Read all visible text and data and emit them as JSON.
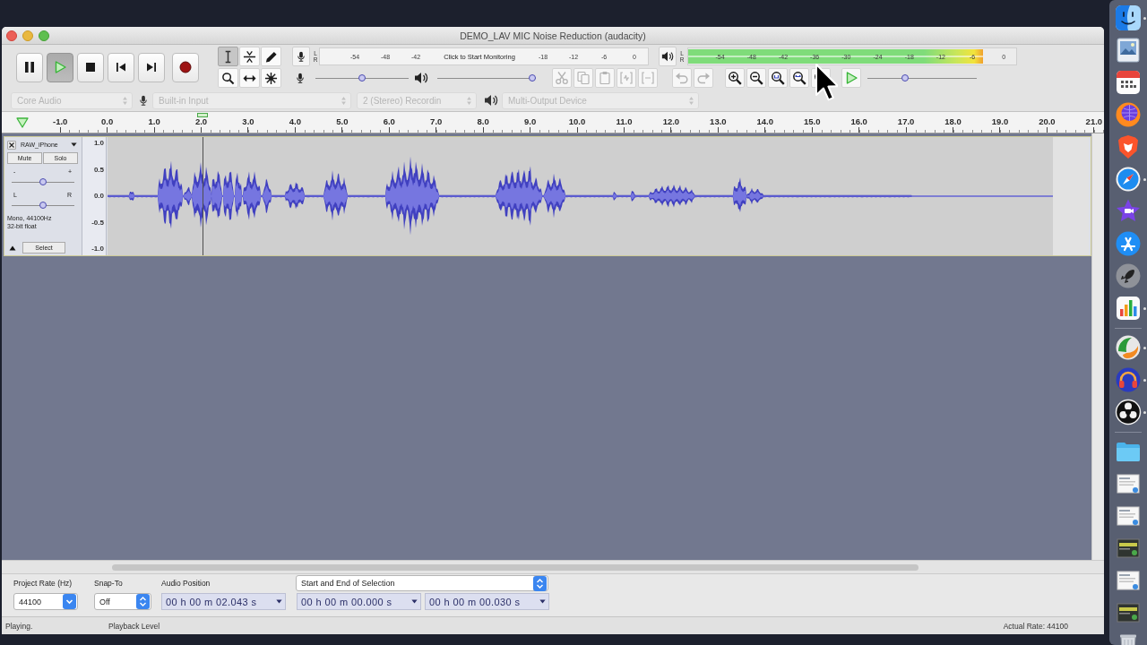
{
  "window": {
    "title": "DEMO_LAV MIC Noise Reduction (audacity)"
  },
  "transport": [
    {
      "kind": "pause",
      "pressed": false
    },
    {
      "kind": "play",
      "pressed": true
    },
    {
      "kind": "stop",
      "pressed": false
    },
    {
      "kind": "skip_start",
      "pressed": false
    },
    {
      "kind": "skip_end",
      "pressed": false
    },
    {
      "kind": "record",
      "pressed": false
    }
  ],
  "tools": [
    {
      "kind": "select",
      "selected": true
    },
    {
      "kind": "envelope",
      "selected": false
    },
    {
      "kind": "draw",
      "selected": false
    },
    {
      "kind": "zoom",
      "selected": false
    },
    {
      "kind": "time_shift",
      "selected": false
    },
    {
      "kind": "multi",
      "selected": false
    }
  ],
  "record_meter": {
    "channels": [
      "L",
      "R"
    ],
    "ticks_before": [
      "-54",
      "-48",
      "-42"
    ],
    "prompt": "Click to Start Monitoring",
    "ticks_after": [
      "-18",
      "-12",
      "-6",
      "0"
    ]
  },
  "playback_meter": {
    "channels": [
      "L",
      "R"
    ],
    "ticks": [
      "-54",
      "-48",
      "-42",
      "-36",
      "-30",
      "-24",
      "-18",
      "-12",
      "-6",
      "0"
    ],
    "level": 0.9
  },
  "mixer": {
    "input": {
      "level": 0.5
    },
    "output": {
      "level": 1
    }
  },
  "edit_tools": [
    {
      "kind": "cut",
      "disabled": true
    },
    {
      "kind": "copy",
      "disabled": true
    },
    {
      "kind": "paste",
      "disabled": true
    },
    {
      "kind": "trim",
      "disabled": true
    },
    {
      "kind": "silence",
      "disabled": true
    },
    {
      "kind": "undo",
      "disabled": true
    },
    {
      "kind": "redo",
      "disabled": true
    },
    {
      "kind": "zoom_in",
      "disabled": false
    },
    {
      "kind": "zoom_out",
      "disabled": false
    },
    {
      "kind": "fit_selection",
      "disabled": false
    },
    {
      "kind": "fit_project",
      "disabled": false
    },
    {
      "kind": "zoom_toggle",
      "disabled": false
    },
    {
      "kind": "play_at_speed",
      "disabled": false
    }
  ],
  "speed_slider": {
    "level": 0.33
  },
  "devices": [
    {
      "kind": "host",
      "value": "Core Audio",
      "disabled": true
    },
    {
      "kind": "input",
      "value": "Built-in Input",
      "disabled": true
    },
    {
      "kind": "channels",
      "value": "2 (Stereo) Recordin",
      "disabled": true
    },
    {
      "kind": "output",
      "value": "Multi-Output Device",
      "disabled": true
    }
  ],
  "ruler": {
    "labels": [
      "-1.0",
      "0.0",
      "1.0",
      "2.0",
      "3.0",
      "4.0",
      "5.0",
      "6.0",
      "7.0",
      "8.0",
      "9.0",
      "10.0",
      "11.0",
      "12.0",
      "13.0",
      "14.0",
      "15.0",
      "16.0",
      "17.0",
      "18.0",
      "19.0",
      "20.0",
      "21.0"
    ]
  },
  "track": {
    "name": "RAW_iPhone",
    "mute": {
      "label": "Mute",
      "on": false
    },
    "solo": {
      "label": "Solo",
      "on": false
    },
    "gain": {
      "min_label": "-",
      "max_label": "+",
      "level": 0.5
    },
    "pan": {
      "min_label": "L",
      "max_label": "R",
      "level": 0.5
    },
    "info": [
      "Mono, 44100Hz",
      "32-bit float"
    ],
    "select_label": "Select",
    "scale": [
      "1.0",
      "0.5",
      "0.0",
      "-0.5",
      "-1.0"
    ]
  },
  "selection_bar": {
    "project_rate": {
      "label": "Project Rate (Hz)",
      "value": "44100"
    },
    "snap_to": {
      "label": "Snap-To",
      "value": "Off"
    },
    "audio_position": {
      "label": "Audio Position",
      "value": "00 h 00 m 02.043 s"
    },
    "selection_mode": "Start and End of Selection",
    "selection_start": "00 h 00 m 00.000 s",
    "selection_end": "00 h 00 m 00.030 s"
  },
  "status_bar": [
    "Playing.",
    "Playback Level",
    "Actual Rate: 44100"
  ],
  "dock": {
    "groups": [
      {
        "items": [
          {
            "kind": "face",
            "running": true
          },
          {
            "kind": "photo_viewer",
            "running": false
          },
          {
            "kind": "calendar",
            "running": false
          },
          {
            "kind": "fox_globe",
            "running": false
          },
          {
            "kind": "shield",
            "running": false
          },
          {
            "kind": "compass",
            "running": true
          },
          {
            "kind": "star",
            "running": false
          },
          {
            "kind": "sticks",
            "running": false
          },
          {
            "kind": "rocket",
            "running": false
          },
          {
            "kind": "bar_chart",
            "running": true
          }
        ]
      },
      {
        "items": [
          {
            "kind": "swirl",
            "running": true
          },
          {
            "kind": "headphones",
            "running": true
          },
          {
            "kind": "aperture",
            "running": true
          }
        ]
      },
      {
        "items": [
          {
            "kind": "folder",
            "running": false
          },
          {
            "kind": "document",
            "running": false
          },
          {
            "kind": "document",
            "running": false
          },
          {
            "kind": "dark_document",
            "running": false
          },
          {
            "kind": "document",
            "running": false
          },
          {
            "kind": "dark_document",
            "running": false
          },
          {
            "kind": "trash",
            "running": false
          }
        ]
      }
    ]
  }
}
